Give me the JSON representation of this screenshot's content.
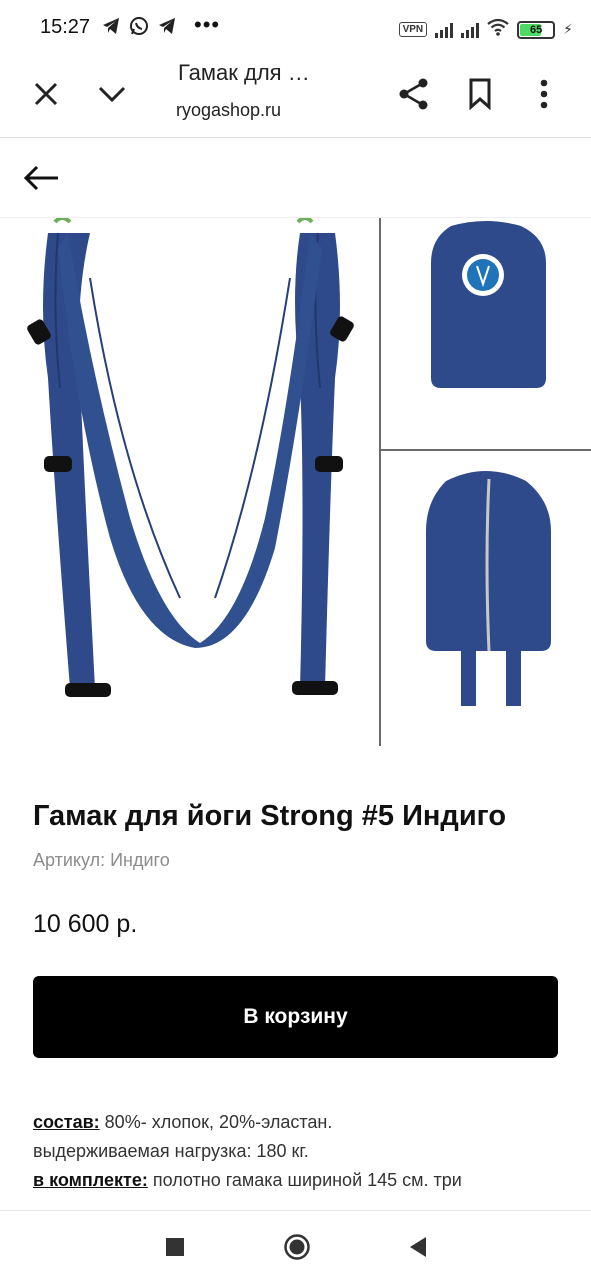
{
  "status_bar": {
    "time": "15:27",
    "app_icons": [
      "telegram-icon",
      "whatsapp-icon",
      "telegram-icon"
    ],
    "more": "•••",
    "vpn": "VPN",
    "battery_level": "65",
    "battery_fraction": 0.65
  },
  "tab_bar": {
    "title": "Гамак для …",
    "url": "ryogashop.ru",
    "icons": [
      "close-icon",
      "chevron-down-icon",
      "share-icon",
      "bookmark-icon",
      "more-vert-icon"
    ]
  },
  "nav": {
    "back_icon": "arrow-left-icon"
  },
  "gallery": {
    "main_image": "blue-aerial-yoga-hammock",
    "thumbnails": [
      "hammock-bag-front-with-logo",
      "hammock-bag-back-with-straps"
    ],
    "fabric_color": "#2f4a8a"
  },
  "product": {
    "title": "Гамак для йоги Strong #5 Индиго",
    "sku": "Артикул: Индиго",
    "price": "10 600 р.",
    "cart_button": "В корзину"
  },
  "description": {
    "line1_label": "состав:",
    "line1_text": " 80%- хлопок, 20%-эластан.",
    "line2_text": "выдерживаемая нагрузка: 180 кг.",
    "line3_label": "в комплекте:",
    "line3_text": " полотно гамака шириной 145 см. три"
  },
  "system_nav": {
    "icons": [
      "recents-square-icon",
      "home-circle-icon",
      "back-triangle-icon"
    ]
  }
}
